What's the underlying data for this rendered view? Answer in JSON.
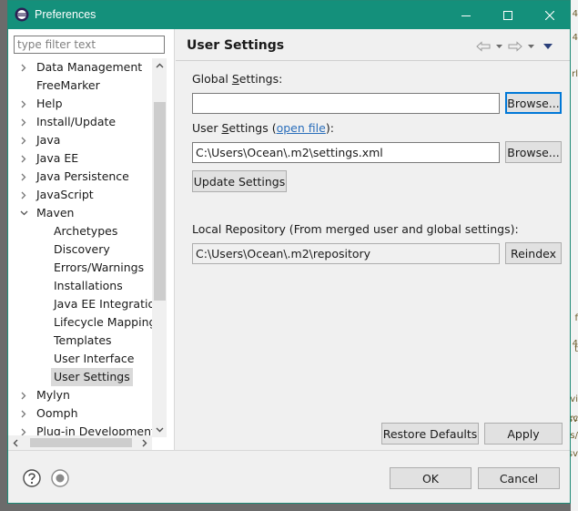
{
  "window": {
    "title": "Preferences"
  },
  "filter": {
    "placeholder": "type filter text"
  },
  "tree": [
    {
      "label": "Data Management",
      "level": 0,
      "expanded": false
    },
    {
      "label": "FreeMarker",
      "level": 0,
      "leaf": true
    },
    {
      "label": "Help",
      "level": 0,
      "expanded": false
    },
    {
      "label": "Install/Update",
      "level": 0,
      "expanded": false
    },
    {
      "label": "Java",
      "level": 0,
      "expanded": false
    },
    {
      "label": "Java EE",
      "level": 0,
      "expanded": false
    },
    {
      "label": "Java Persistence",
      "level": 0,
      "expanded": false
    },
    {
      "label": "JavaScript",
      "level": 0,
      "expanded": false
    },
    {
      "label": "Maven",
      "level": 0,
      "expanded": true
    },
    {
      "label": "Archetypes",
      "level": 1,
      "leaf": true
    },
    {
      "label": "Discovery",
      "level": 1,
      "leaf": true
    },
    {
      "label": "Errors/Warnings",
      "level": 1,
      "leaf": true
    },
    {
      "label": "Installations",
      "level": 1,
      "leaf": true
    },
    {
      "label": "Java EE Integration",
      "level": 1,
      "leaf": true
    },
    {
      "label": "Lifecycle Mapping",
      "level": 1,
      "leaf": true
    },
    {
      "label": "Templates",
      "level": 1,
      "leaf": true
    },
    {
      "label": "User Interface",
      "level": 1,
      "leaf": true
    },
    {
      "label": "User Settings",
      "level": 1,
      "leaf": true,
      "selected": true
    },
    {
      "label": "Mylyn",
      "level": 0,
      "expanded": false
    },
    {
      "label": "Oomph",
      "level": 0,
      "expanded": false
    },
    {
      "label": "Plug-in Development",
      "level": 0,
      "expanded": false
    }
  ],
  "pane": {
    "title": "User Settings",
    "global": {
      "label_pre": "Global ",
      "label_mnemonic": "S",
      "label_post": "ettings:",
      "value": "",
      "browse": "Browse..."
    },
    "user": {
      "label_pre": "User ",
      "label_mnemonic": "S",
      "label_post": "ettings (",
      "link": "open file",
      "label_end": "):",
      "value": "C:\\Users\\Ocean\\.m2\\settings.xml",
      "browse": "Browse..."
    },
    "update_button": "Update Settings",
    "local_repo": {
      "label": "Local Repository (From merged user and global settings):",
      "value": "C:\\Users\\Ocean\\.m2\\repository",
      "reindex": "Reindex"
    },
    "restore_defaults": "Restore Defaults",
    "apply": "Apply"
  },
  "bottom": {
    "ok": "OK",
    "cancel": "Cancel"
  },
  "colors": {
    "titlebar": "#14907b",
    "link": "#2a6ebb",
    "focus": "#0078d7",
    "selection": "#d9d9d9"
  },
  "edge_fragments": [
    "4",
    "4",
    "rl",
    "4",
    "f",
    "t",
    "rc",
    "vi",
    "sv",
    "s/",
    "sv"
  ]
}
